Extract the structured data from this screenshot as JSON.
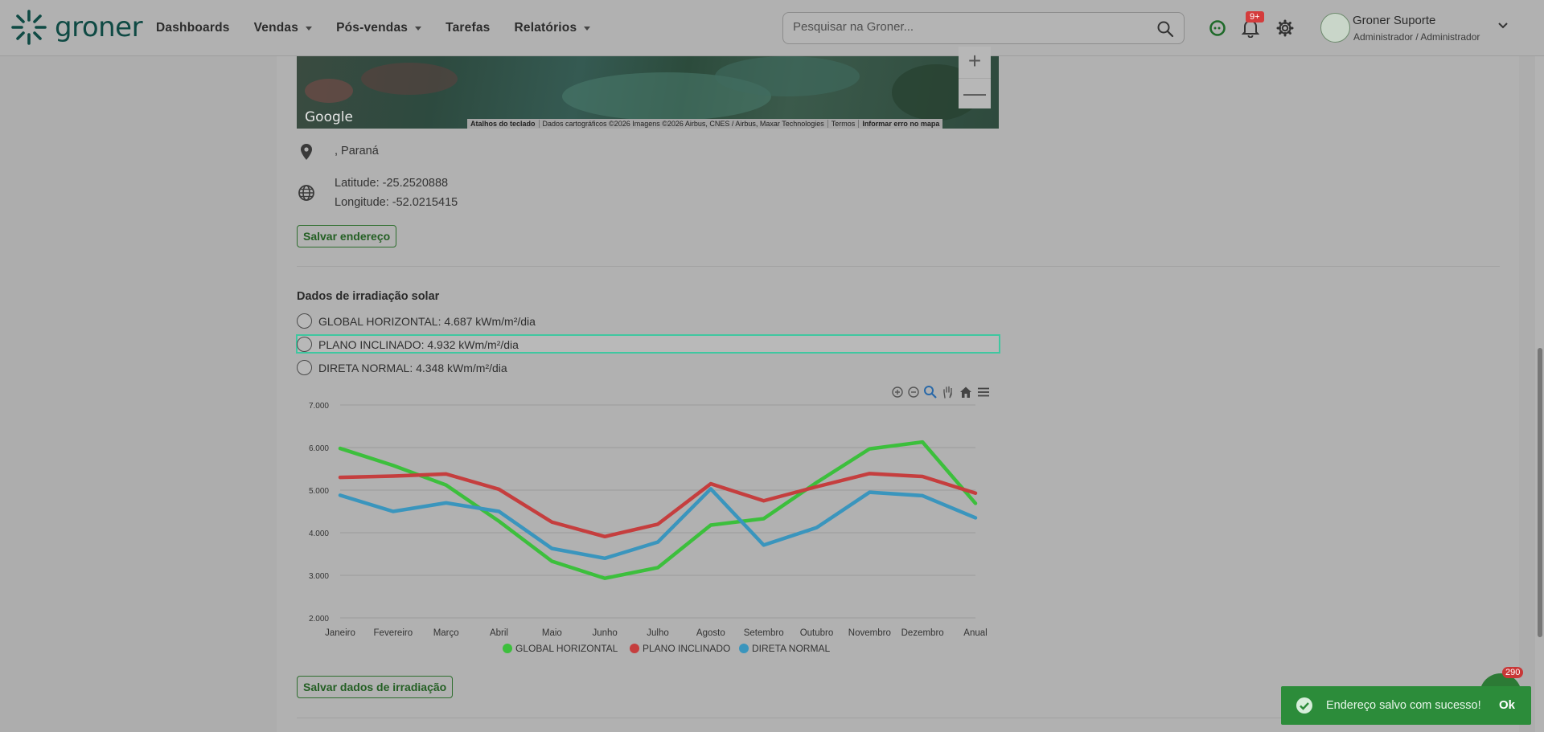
{
  "brand": {
    "name": "groner",
    "color": "#0f4a44"
  },
  "nav": [
    {
      "label": "Dashboards",
      "dropdown": false
    },
    {
      "label": "Vendas",
      "dropdown": true
    },
    {
      "label": "Pós-vendas",
      "dropdown": true
    },
    {
      "label": "Tarefas",
      "dropdown": false
    },
    {
      "label": "Relatórios",
      "dropdown": true
    }
  ],
  "search": {
    "placeholder": "Pesquisar na Groner..."
  },
  "notifications": {
    "badge": "9+"
  },
  "user": {
    "name": "Groner Suporte",
    "role": "Administrador / Administrador"
  },
  "map": {
    "google_label": "Google",
    "attribution": [
      "Atalhos do teclado",
      "Dados cartográficos ©2026 Imagens ©2026 Airbus, CNES / Airbus, Maxar Technologies",
      "Termos",
      "Informar erro no mapa"
    ],
    "zoom_in": "+",
    "zoom_out": "—"
  },
  "address": {
    "text": ", Paraná",
    "latitude": "Latitude: -25.2520888",
    "longitude": "Longitude: -52.0215415",
    "save_label": "Salvar endereço"
  },
  "irradiation": {
    "title": "Dados de irradiação solar",
    "options": [
      "GLOBAL HORIZONTAL: 4.687 kWm/m²/dia",
      "PLANO INCLINADO: 4.932 kWm/m²/dia",
      "DIRETA NORMAL: 4.348 kWm/m²/dia"
    ],
    "save_label": "Salvar dados de irradiação"
  },
  "chart_data": {
    "type": "line",
    "categories": [
      "Janeiro",
      "Fevereiro",
      "Março",
      "Abril",
      "Maio",
      "Junho",
      "Julho",
      "Agosto",
      "Setembro",
      "Outubro",
      "Novembro",
      "Dezembro",
      "Anual"
    ],
    "series": [
      {
        "name": "GLOBAL HORIZONTAL",
        "color": "#3cbf3c",
        "values": [
          5.98,
          5.58,
          5.12,
          4.27,
          3.33,
          2.93,
          3.18,
          4.18,
          4.33,
          5.18,
          5.97,
          6.13,
          4.69
        ]
      },
      {
        "name": "PLANO INCLINADO",
        "color": "#c53e3e",
        "values": [
          5.3,
          5.33,
          5.38,
          5.02,
          4.25,
          3.91,
          4.2,
          5.15,
          4.75,
          5.08,
          5.39,
          5.32,
          4.93
        ]
      },
      {
        "name": "DIRETA NORMAL",
        "color": "#3a95bd",
        "values": [
          4.88,
          4.5,
          4.7,
          4.5,
          3.63,
          3.4,
          3.78,
          5.03,
          3.71,
          4.12,
          4.95,
          4.87,
          4.35
        ]
      }
    ],
    "y_ticks": [
      "7.000",
      "6.000",
      "5.000",
      "4.000",
      "3.000",
      "2.000"
    ],
    "ylim": [
      2,
      7
    ],
    "grid": true,
    "legend": "bottom-center"
  },
  "toast": {
    "message": "Endereço salvo com sucesso!",
    "action": "Ok"
  },
  "chat": {
    "badge": "290"
  }
}
